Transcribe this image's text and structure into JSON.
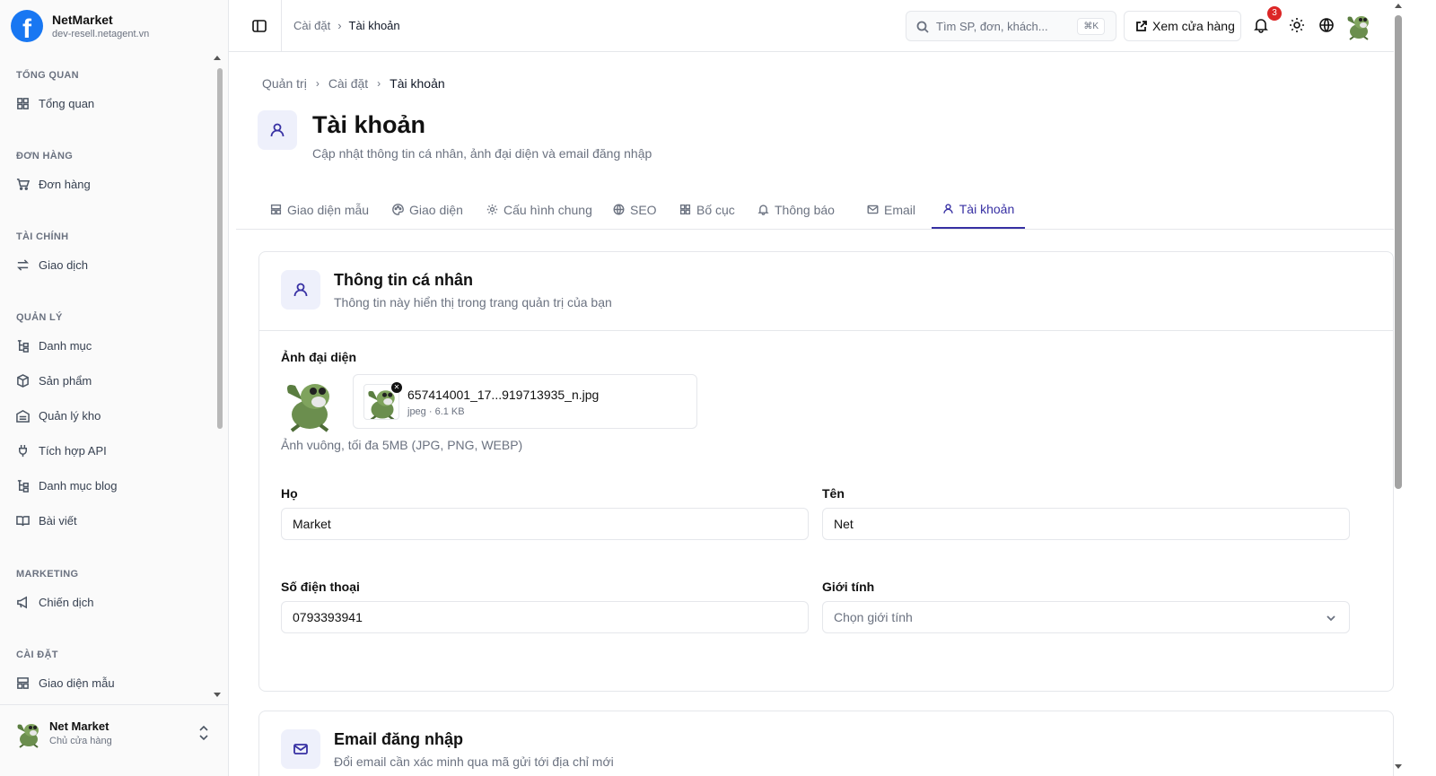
{
  "brand": {
    "name": "NetMarket",
    "domain": "dev-resell.netagent.vn"
  },
  "sidebar": {
    "sections": [
      {
        "title": "TỔNG QUAN",
        "items": [
          {
            "label": "Tổng quan",
            "icon": "grid-icon"
          }
        ]
      },
      {
        "title": "ĐƠN HÀNG",
        "items": [
          {
            "label": "Đơn hàng",
            "icon": "cart-icon"
          }
        ]
      },
      {
        "title": "TÀI CHÍNH",
        "items": [
          {
            "label": "Giao dịch",
            "icon": "transfer-icon"
          }
        ]
      },
      {
        "title": "QUẢN LÝ",
        "items": [
          {
            "label": "Danh mục",
            "icon": "tree-icon"
          },
          {
            "label": "Sản phẩm",
            "icon": "box-icon"
          },
          {
            "label": "Quản lý kho",
            "icon": "warehouse-icon"
          },
          {
            "label": "Tích hợp API",
            "icon": "plug-icon"
          },
          {
            "label": "Danh mục blog",
            "icon": "tree-icon"
          },
          {
            "label": "Bài viết",
            "icon": "book-icon"
          }
        ]
      },
      {
        "title": "MARKETING",
        "items": [
          {
            "label": "Chiến dịch",
            "icon": "megaphone-icon"
          }
        ]
      },
      {
        "title": "CÀI ĐẶT",
        "items": [
          {
            "label": "Giao diện mẫu",
            "icon": "template-icon"
          }
        ]
      }
    ],
    "user": {
      "name": "Net Market",
      "role": "Chủ cửa hàng"
    }
  },
  "topbar": {
    "breadcrumb": [
      "Cài đặt",
      "Tài khoản"
    ],
    "search_placeholder": "Tìm SP, đơn, khách...",
    "search_shortcut": "⌘K",
    "view_store": "Xem cửa hàng",
    "notification_count": "3"
  },
  "page": {
    "breadcrumb": [
      "Quản trị",
      "Cài đặt",
      "Tài khoản"
    ],
    "title": "Tài khoản",
    "subtitle": "Cập nhật thông tin cá nhân, ảnh đại diện và email đăng nhập"
  },
  "tabs": [
    {
      "label": "Giao diện mẫu",
      "icon": "template-icon"
    },
    {
      "label": "Giao diện",
      "icon": "palette-icon"
    },
    {
      "label": "Cấu hình chung",
      "icon": "gear-icon"
    },
    {
      "label": "SEO",
      "icon": "globe-icon"
    },
    {
      "label": "Bố cục",
      "icon": "grid-icon"
    },
    {
      "label": "Thông báo",
      "icon": "bell-icon"
    },
    {
      "label": "Email",
      "icon": "mail-icon"
    },
    {
      "label": "Tài khoản",
      "icon": "user-icon",
      "active": true
    }
  ],
  "profile_card": {
    "title": "Thông tin cá nhân",
    "subtitle": "Thông tin này hiển thị trong trang quản trị của bạn",
    "avatar_label": "Ảnh đại diện",
    "file_name": "657414001_17...919713935_n.jpg",
    "file_meta": "jpeg · 6.1 KB",
    "avatar_hint": "Ảnh vuông, tối đa 5MB (JPG, PNG, WEBP)",
    "last_name_label": "Họ",
    "last_name_value": "Market",
    "first_name_label": "Tên",
    "first_name_value": "Net",
    "phone_label": "Số điện thoại",
    "phone_value": "0793393941",
    "gender_label": "Giới tính",
    "gender_placeholder": "Chọn giới tính"
  },
  "email_card": {
    "title": "Email đăng nhập",
    "subtitle": "Đổi email cần xác minh qua mã gửi tới địa chỉ mới"
  },
  "colors": {
    "accent": "#3730a3",
    "brand": "#1877f2",
    "badge": "#dc2626"
  }
}
